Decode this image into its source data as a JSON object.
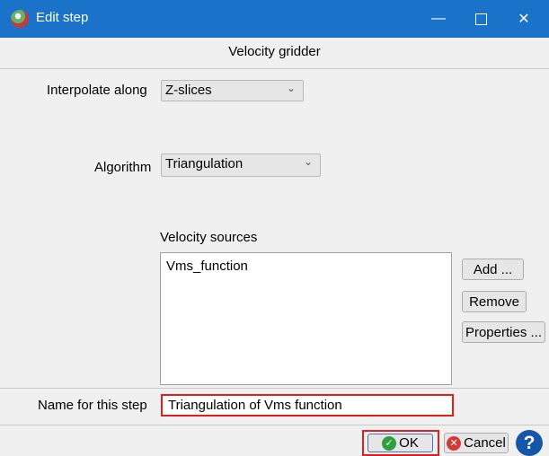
{
  "window": {
    "title": "Edit step",
    "minimize_glyph": "—",
    "close_glyph": "✕"
  },
  "header": {
    "title": "Velocity gridder"
  },
  "interpolate": {
    "label": "Interpolate along",
    "value": "Z-slices"
  },
  "algorithm": {
    "label": "Algorithm",
    "value": "Triangulation"
  },
  "velocity_sources": {
    "label": "Velocity sources",
    "items": [
      "Vms_function"
    ],
    "add_label": "Add ...",
    "remove_label": "Remove",
    "properties_label": "Properties ..."
  },
  "step_name": {
    "label": "Name for this step",
    "value": "Triangulation of Vms function"
  },
  "footer": {
    "ok_label": "OK",
    "cancel_label": "Cancel",
    "help_glyph": "?"
  },
  "icons": {
    "app": "app-logo-icon",
    "ok": "check-circle-icon",
    "cancel": "x-circle-icon",
    "help": "help-icon",
    "dropdown": "chevron-down-icon"
  },
  "colors": {
    "titlebar": "#1a73c8",
    "highlight": "#e01f1f",
    "ok_icon": "#2e9e3e",
    "cancel_icon": "#d23a3a",
    "help": "#1755a8"
  }
}
